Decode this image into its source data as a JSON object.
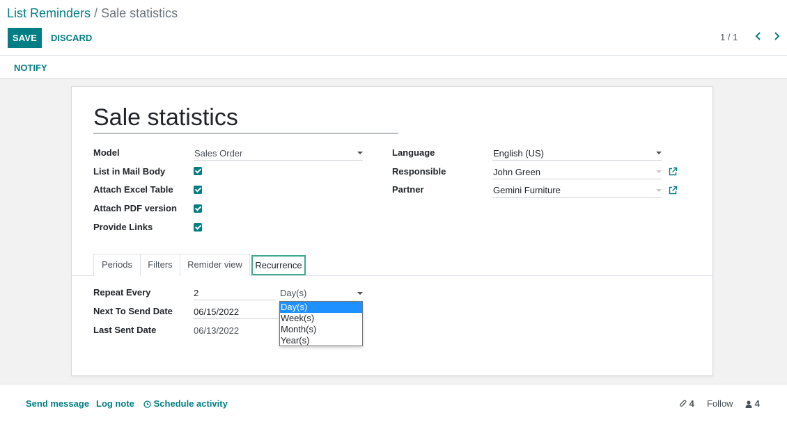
{
  "breadcrumb": {
    "parent": "List Reminders",
    "separator": " / ",
    "current": "Sale statistics"
  },
  "toolbar": {
    "save_label": "SAVE",
    "discard_label": "DISCARD"
  },
  "pager": {
    "value": "1 / 1"
  },
  "statusbar": {
    "notify_label": "NOTIFY"
  },
  "form": {
    "title": "Sale statistics",
    "left": {
      "model_label": "Model",
      "model_value": "Sales Order",
      "list_in_mail_body_label": "List in Mail Body",
      "list_in_mail_body_checked": true,
      "attach_excel_label": "Attach Excel Table",
      "attach_excel_checked": true,
      "attach_pdf_label": "Attach PDF version",
      "attach_pdf_checked": true,
      "provide_links_label": "Provide Links",
      "provide_links_checked": true
    },
    "right": {
      "language_label": "Language",
      "language_value": "English (US)",
      "responsible_label": "Responsible",
      "responsible_value": "John Green",
      "partner_label": "Partner",
      "partner_value": "Gemini Furniture"
    },
    "tabs": [
      {
        "label": "Periods",
        "active": false
      },
      {
        "label": "Filters",
        "active": false
      },
      {
        "label": "Remider view",
        "active": false
      },
      {
        "label": "Recurrence",
        "active": true
      }
    ],
    "recurrence": {
      "repeat_every_label": "Repeat Every",
      "repeat_every_value": "2",
      "repeat_unit_value": "Day(s)",
      "repeat_unit_options": [
        "Day(s)",
        "Week(s)",
        "Month(s)",
        "Year(s)"
      ],
      "next_to_send_label": "Next To Send Date",
      "next_to_send_value": "06/15/2022",
      "last_sent_label": "Last Sent Date",
      "last_sent_value": "06/13/2022"
    }
  },
  "chatter": {
    "send_message": "Send message",
    "log_note": "Log note",
    "schedule_activity": "Schedule activity",
    "attachments_count": "4",
    "follow_label": "Follow",
    "followers_count": "4"
  },
  "colors": {
    "primary": "#017e84",
    "active_tab_border": "#3fa98d",
    "dropdown_highlight": "#1e90ff"
  }
}
